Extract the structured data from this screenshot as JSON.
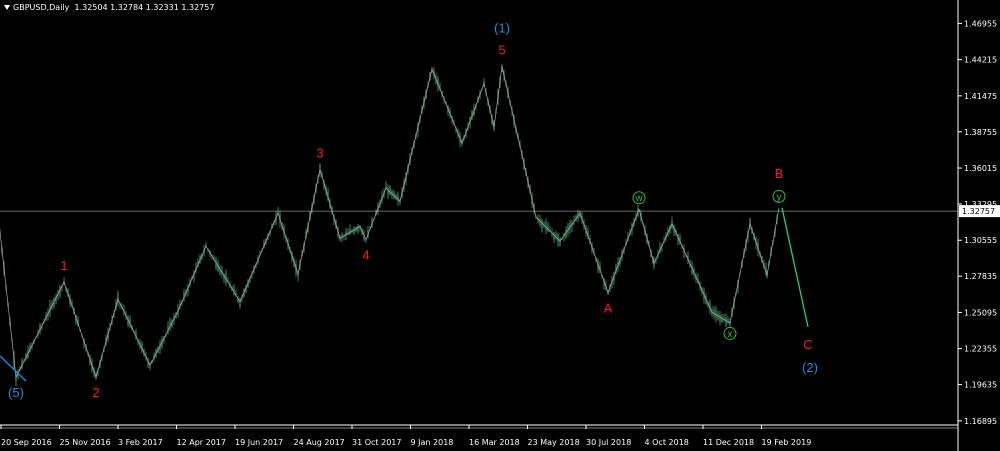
{
  "header": {
    "symbol": "GBPUSD,Daily",
    "ohlc": "1.32504 1.32784 1.32331 1.32757"
  },
  "colors": {
    "background": "#000000",
    "candles": "#2f7a52",
    "wick": "#5fb88a",
    "zigzag": "#a8a8a8",
    "blue_wave": "#1c8fe0",
    "red_label": "#ff1a1a",
    "blue_label": "#1c8fe0",
    "green_label": "#2fbf3f",
    "projection": "#1fd46a",
    "price_line": "#8a8a8a"
  },
  "chart_data": {
    "type": "line",
    "series_name": "",
    "ylim": [
      1.1658,
      1.4812
    ],
    "y_ticks": [
      "1.46955",
      "1.44215",
      "1.41475",
      "1.38755",
      "1.36015",
      "1.33295",
      "1.30555",
      "1.27835",
      "1.25095",
      "1.22355",
      "1.19635",
      "1.16895"
    ],
    "x_ticks": [
      "20 Sep 2016",
      "25 Nov 2016",
      "3 Feb 2017",
      "12 Apr 2017",
      "19 Jun 2017",
      "24 Aug 2017",
      "31 Oct 2017",
      "9 Jan 2018",
      "16 Mar 2018",
      "23 May 2018",
      "30 Jul 2018",
      "4 Oct 2018",
      "11 Dec 2018",
      "19 Feb 2019"
    ],
    "current_price": 1.32757,
    "current_price_label": "1.32757",
    "swing_points": [
      {
        "i": 0,
        "y": 1.312
      },
      {
        "i": 16,
        "y": 1.202,
        "label": "(5)",
        "label_color": "blue"
      },
      {
        "i": 64,
        "y": 1.274,
        "label": "1",
        "label_color": "red"
      },
      {
        "i": 96,
        "y": 1.202,
        "label": "2",
        "label_color": "red"
      },
      {
        "i": 118,
        "y": 1.261
      },
      {
        "i": 150,
        "y": 1.211
      },
      {
        "i": 178,
        "y": 1.252
      },
      {
        "i": 206,
        "y": 1.301
      },
      {
        "i": 240,
        "y": 1.259
      },
      {
        "i": 278,
        "y": 1.326
      },
      {
        "i": 298,
        "y": 1.28
      },
      {
        "i": 320,
        "y": 1.359,
        "label": "3",
        "label_color": "red"
      },
      {
        "i": 340,
        "y": 1.307
      },
      {
        "i": 360,
        "y": 1.316
      },
      {
        "i": 366,
        "y": 1.306,
        "label": "4",
        "label_color": "red"
      },
      {
        "i": 386,
        "y": 1.345
      },
      {
        "i": 400,
        "y": 1.335
      },
      {
        "i": 432,
        "y": 1.435
      },
      {
        "i": 462,
        "y": 1.379
      },
      {
        "i": 484,
        "y": 1.424
      },
      {
        "i": 494,
        "y": 1.391
      },
      {
        "i": 502,
        "y": 1.437,
        "label": "5",
        "label_color": "red",
        "label2": "(1)",
        "label2_color": "blue"
      },
      {
        "i": 536,
        "y": 1.323
      },
      {
        "i": 560,
        "y": 1.305
      },
      {
        "i": 580,
        "y": 1.326
      },
      {
        "i": 608,
        "y": 1.266,
        "label": "A",
        "label_color": "red"
      },
      {
        "i": 639,
        "y": 1.329,
        "label": "w",
        "label_color": "green"
      },
      {
        "i": 654,
        "y": 1.288
      },
      {
        "i": 672,
        "y": 1.318
      },
      {
        "i": 712,
        "y": 1.251
      },
      {
        "i": 730,
        "y": 1.243,
        "label": "x",
        "label_color": "green"
      },
      {
        "i": 750,
        "y": 1.318
      },
      {
        "i": 767,
        "y": 1.279
      },
      {
        "i": 779,
        "y": 1.33,
        "label": "y",
        "label_color": "green",
        "label2": "B",
        "label2_color": "red"
      }
    ],
    "projection": {
      "from": {
        "i": 782,
        "y": 1.33
      },
      "to": {
        "i": 808,
        "y": 1.24
      },
      "label": "C",
      "label_color": "red",
      "label2": "(2)",
      "label2_color": "blue"
    },
    "blue_wave_starts": [
      {
        "i": 0,
        "y": 1.218
      },
      {
        "i": 26,
        "y": 1.199
      }
    ]
  }
}
